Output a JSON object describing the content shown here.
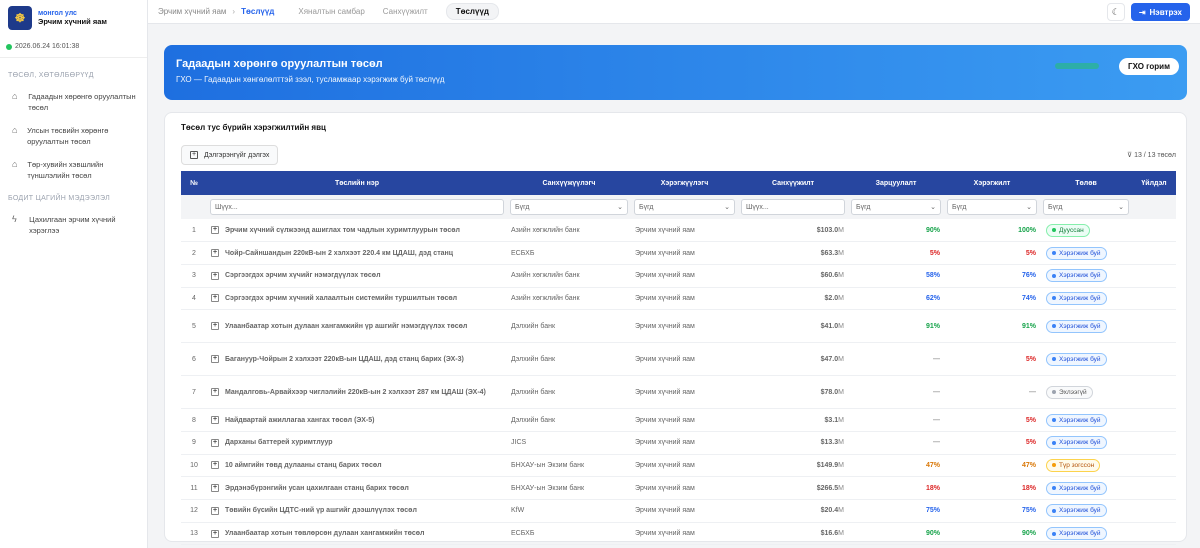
{
  "sidebar": {
    "org_line": "монгол улс",
    "title": "Эрчим хүчний яам",
    "datetime": "2026.06.24 16:01:38",
    "section1": "ТӨСӨЛ, ХӨТӨЛБӨРҮҮД",
    "items": [
      {
        "label": "Гадаадын хөрөнгө оруулалтын төсөл",
        "icon": "building-icon"
      },
      {
        "label": "Улсын төсвийн хөрөнгө оруулалтын төсөл",
        "icon": "building-icon"
      },
      {
        "label": "Төр-хувийн хэвшлийн түншлэлийн төсөл",
        "icon": "building-icon"
      }
    ],
    "section2": "БОДИТ ЦАГИЙН МЭДЭЭЛЭЛ",
    "items2": [
      {
        "label": "Цахилгаан эрчим хүчний хэрэглээ",
        "icon": "bolt-icon"
      }
    ]
  },
  "topbar": {
    "breadcrumb_root": "Эрчим хүчний яам",
    "breadcrumb_current": "Төслүүд",
    "tabs": [
      "Хяналтын самбар",
      "Санхүүжилт",
      "Төслүүд"
    ],
    "login_label": "Нэвтрэх"
  },
  "banner": {
    "title": "Гадаадын хөрөнгө оруулалтын төсөл",
    "subtitle": "ГХО — Гадаадын хөнгөлөлттэй зээл, тусламжаар хэрэгжиж буй төслүүд",
    "button_label": "ГХО горим"
  },
  "card": {
    "title": "Төсөл тус бүрийн хэрэгжилтийн явц",
    "expand_label": "Дэлгэрэнгүйг дэлгэх",
    "filter_count": "13 / 13 төсөл"
  },
  "table": {
    "headers": [
      "№",
      "Төслийн нэр",
      "Санхүүжүүлэгч",
      "Хэрэгжүүлэгч",
      "Санхүүжилт",
      "Зарцуулалт",
      "Хэрэгжилт",
      "Төлөв",
      "Үйлдэл"
    ],
    "filters": {
      "search_placeholder": "Шүүх...",
      "all_option": "Бүгд"
    },
    "rows": [
      {
        "no": "1",
        "name": "Эрчим хүчний сүлжээнд ашиглах том чадлын хуримтлуурын төсөл",
        "financier": "Азийн хөгжлийн банк",
        "implementer": "Эрчим хүчний яам",
        "amount": "$103.0",
        "unit": "M",
        "spend": "90%",
        "spend_color": "#16a34a",
        "impl": "100%",
        "impl_color": "#16a34a",
        "status": "Дууссан",
        "status_type": "done"
      },
      {
        "no": "2",
        "name": "Чойр-Сайншандын 220кВ-ын 2 хэлхээт 220.4 км ЦДАШ, дэд станц",
        "financier": "ЕСБХБ",
        "implementer": "Эрчим хүчний яам",
        "amount": "$63.3",
        "unit": "M",
        "spend": "5%",
        "spend_color": "#dc2626",
        "impl": "5%",
        "impl_color": "#dc2626",
        "status": "Хэрэгжиж буй",
        "status_type": "active"
      },
      {
        "no": "3",
        "name": "Сэргээгдэх эрчим хүчийг нэмэгдүүлэх төсөл",
        "financier": "Азийн хөгжлийн банк",
        "implementer": "Эрчим хүчний яам",
        "amount": "$60.6",
        "unit": "M",
        "spend": "58%",
        "spend_color": "#2563eb",
        "impl": "76%",
        "impl_color": "#2563eb",
        "status": "Хэрэгжиж буй",
        "status_type": "active"
      },
      {
        "no": "4",
        "name": "Сэргээгдэх эрчим хүчний халаалтын системийн туршилтын төсөл",
        "financier": "Азийн хөгжлийн банк",
        "implementer": "Эрчим хүчний яам",
        "amount": "$2.0",
        "unit": "M",
        "spend": "62%",
        "spend_color": "#2563eb",
        "impl": "74%",
        "impl_color": "#2563eb",
        "status": "Хэрэгжиж буй",
        "status_type": "active"
      },
      {
        "no": "5",
        "name": "Улаанбаатар хотын дулаан хангамжийн үр ашгийг нэмэгдүүлэх төсөл",
        "financier": "Дэлхийн банк",
        "implementer": "Эрчим хүчний яам",
        "amount": "$41.0",
        "unit": "M",
        "spend": "91%",
        "spend_color": "#16a34a",
        "impl": "91%",
        "impl_color": "#16a34a",
        "status": "Хэрэгжиж буй",
        "status_type": "active"
      },
      {
        "no": "6",
        "name": "Багануур-Чойрын 2 хэлхээт 220кВ-ын ЦДАШ, дэд станц барих (ЭХ-3)",
        "financier": "Дэлхийн банк",
        "implementer": "Эрчим хүчний яам",
        "amount": "$47.0",
        "unit": "M",
        "spend": "—",
        "spend_color": "#999999",
        "impl": "5%",
        "impl_color": "#dc2626",
        "status": "Хэрэгжиж буй",
        "status_type": "active"
      },
      {
        "no": "7",
        "name": "Мандалговь-Арвайхээр чиглэлийн 220кВ-ын 2 хэлхээт 287 км ЦДАШ (ЭХ-4)",
        "financier": "Дэлхийн банк",
        "implementer": "Эрчим хүчний яам",
        "amount": "$78.0",
        "unit": "M",
        "spend": "—",
        "spend_color": "#999999",
        "impl": "—",
        "impl_color": "#999999",
        "status": "Эхлээгүй",
        "status_type": "pending"
      },
      {
        "no": "8",
        "name": "Найдвартай ажиллагаа хангах төсөл (ЭХ-5)",
        "financier": "Дэлхийн банк",
        "implementer": "Эрчим хүчний яам",
        "amount": "$3.1",
        "unit": "M",
        "spend": "—",
        "spend_color": "#999999",
        "impl": "5%",
        "impl_color": "#dc2626",
        "status": "Хэрэгжиж буй",
        "status_type": "active"
      },
      {
        "no": "9",
        "name": "Дарханы баттерей хуримтлуур",
        "financier": "JICS",
        "implementer": "Эрчим хүчний яам",
        "amount": "$13.3",
        "unit": "M",
        "spend": "—",
        "spend_color": "#999999",
        "impl": "5%",
        "impl_color": "#dc2626",
        "status": "Хэрэгжиж буй",
        "status_type": "active"
      },
      {
        "no": "10",
        "name": "10 аймгийн төвд дулааны станц барих төсөл",
        "financier": "БНХАУ-ын Экзим банк",
        "implementer": "Эрчим хүчний яам",
        "amount": "$149.9",
        "unit": "M",
        "spend": "47%",
        "spend_color": "#d97706",
        "impl": "47%",
        "impl_color": "#d97706",
        "status": "Түр зогссон",
        "status_type": "paused"
      },
      {
        "no": "11",
        "name": "Эрдэнэбүрэнгийн усан цахилгаан станц барих төсөл",
        "financier": "БНХАУ-ын Экзим банк",
        "implementer": "Эрчим хүчний яам",
        "amount": "$266.5",
        "unit": "M",
        "spend": "18%",
        "spend_color": "#dc2626",
        "impl": "18%",
        "impl_color": "#dc2626",
        "status": "Хэрэгжиж буй",
        "status_type": "active"
      },
      {
        "no": "12",
        "name": "Төвийн бүсийн ЦДТС-ний үр ашгийг дээшлүүлэх төсөл",
        "financier": "KfW",
        "implementer": "Эрчим хүчний яам",
        "amount": "$20.4",
        "unit": "M",
        "spend": "75%",
        "spend_color": "#2563eb",
        "impl": "75%",
        "impl_color": "#2563eb",
        "status": "Хэрэгжиж буй",
        "status_type": "active"
      },
      {
        "no": "13",
        "name": "Улаанбаатар хотын төвлөрсөн дулаан хангамжийн төсөл",
        "financier": "ЕСБХБ",
        "implementer": "Эрчим хүчний яам",
        "amount": "$16.6",
        "unit": "M",
        "spend": "90%",
        "spend_color": "#16a34a",
        "impl": "90%",
        "impl_color": "#16a34a",
        "status": "Хэрэгжиж буй",
        "status_type": "active"
      }
    ]
  },
  "status_colors": {
    "done": {
      "bg": "#ecfdf5",
      "border": "#86efac",
      "text": "#15803d",
      "dot": "#22c55e"
    },
    "active": {
      "bg": "#eff6ff",
      "border": "#93c5fd",
      "text": "#1d4ed8",
      "dot": "#3b82f6"
    },
    "pending": {
      "bg": "#f9fafb",
      "border": "#d1d5db",
      "text": "#555555",
      "dot": "#9ca3af"
    },
    "paused": {
      "bg": "#fffbeb",
      "border": "#fcd34d",
      "text": "#b45309",
      "dot": "#f59e0b"
    }
  }
}
